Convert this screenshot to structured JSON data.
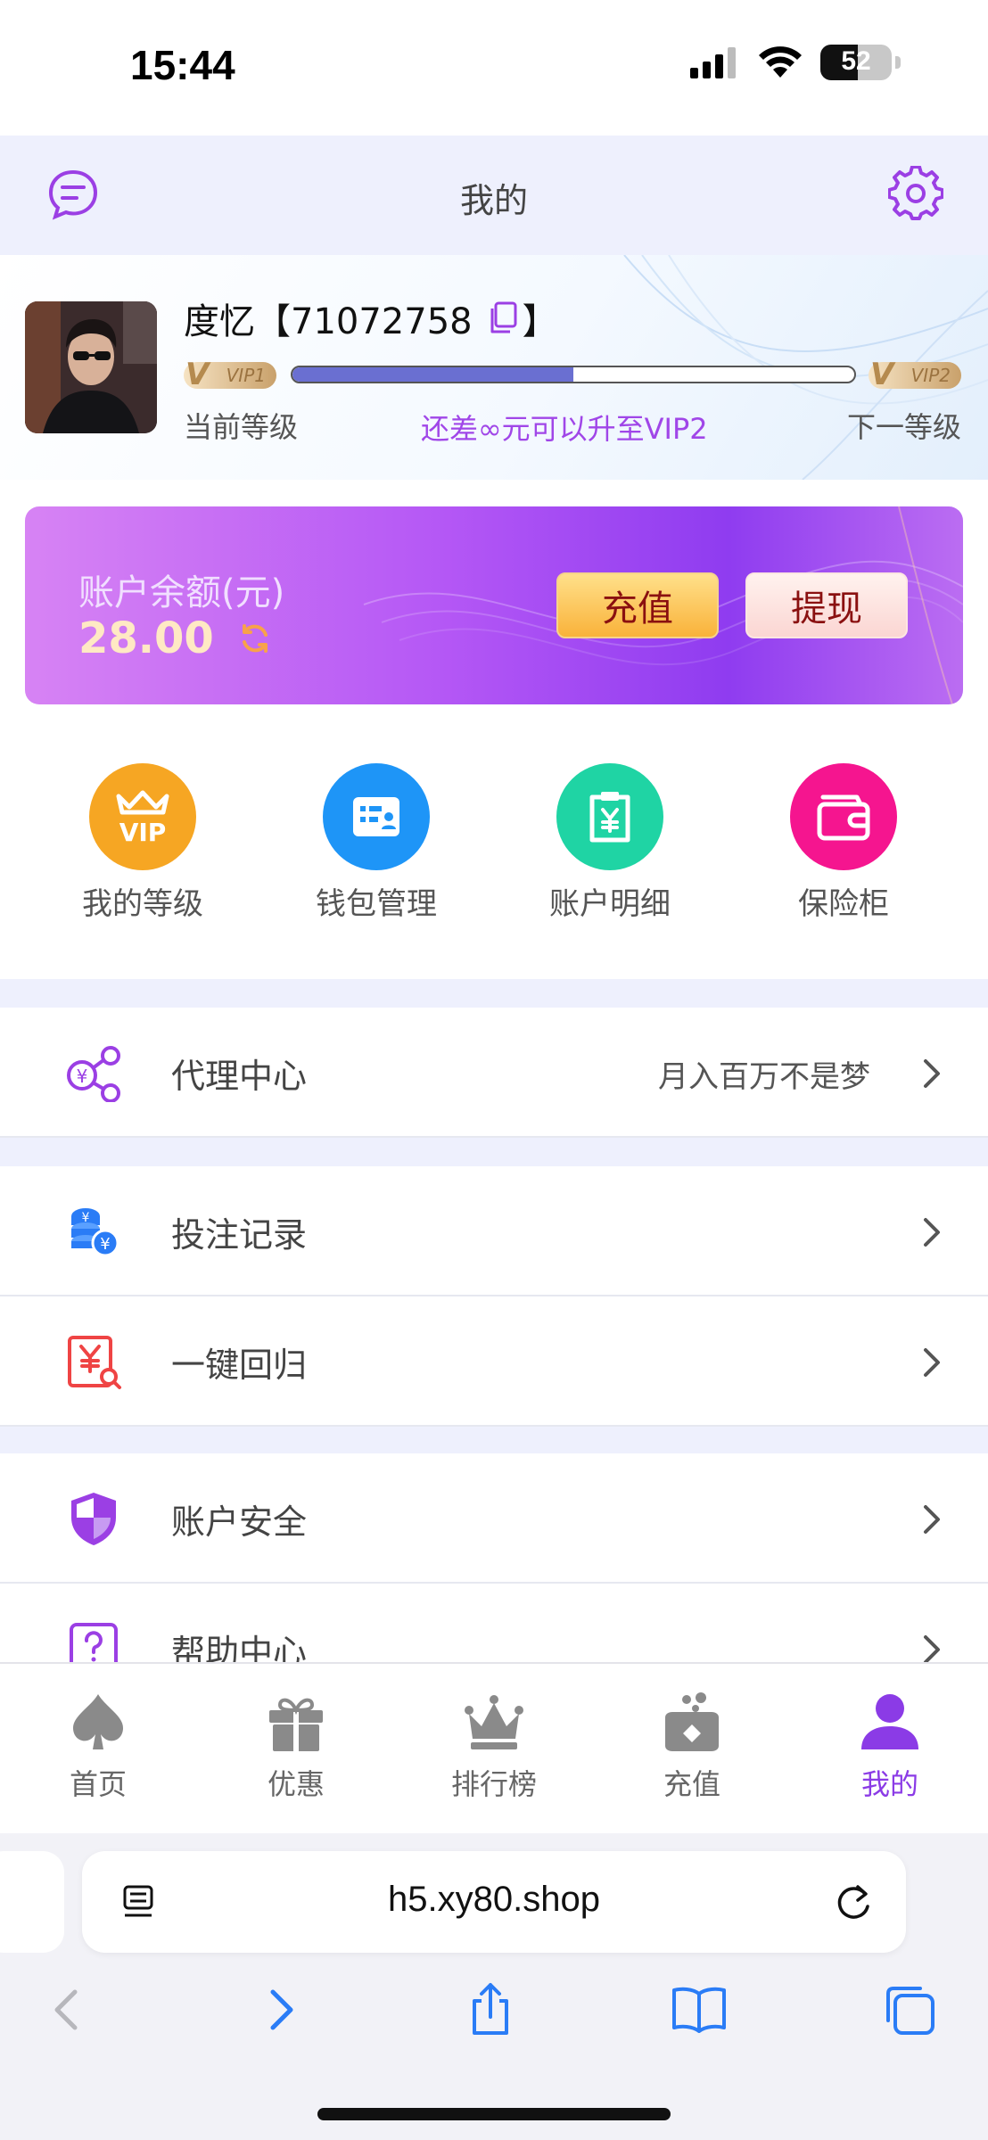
{
  "status": {
    "time": "15:44",
    "battery": "52",
    "battery_level": 0.52
  },
  "header": {
    "title": "我的"
  },
  "profile": {
    "name": "度忆【71072758",
    "name_close": "】",
    "vip_current": "VIP1",
    "vip_next": "VIP2",
    "progress": 0.5,
    "current_level_label": "当前等级",
    "upgrade_tip": "还差∞元可以升至VIP2",
    "next_level_label": "下一等级"
  },
  "balance": {
    "label": "账户余额(元)",
    "amount": "28.00",
    "recharge_label": "充值",
    "withdraw_label": "提现"
  },
  "quick_actions": [
    {
      "label": "我的等级",
      "icon": "vip-crown-icon",
      "color": "#f6a623"
    },
    {
      "label": "钱包管理",
      "icon": "wallet-card-icon",
      "color": "#1e95f7"
    },
    {
      "label": "账户明细",
      "icon": "clipboard-yen-icon",
      "color": "#1fd4a4"
    },
    {
      "label": "保险柜",
      "icon": "safe-wallet-icon",
      "color": "#f5158f"
    }
  ],
  "menu": {
    "agent": {
      "label": "代理中心",
      "extra": "月入百万不是梦"
    },
    "bet_records": {
      "label": "投注记录"
    },
    "one_click": {
      "label": "一键回归"
    },
    "security": {
      "label": "账户安全"
    },
    "help": {
      "label": "帮助中心"
    }
  },
  "tabs": [
    {
      "label": "首页",
      "icon": "spade-icon"
    },
    {
      "label": "优惠",
      "icon": "gift-icon"
    },
    {
      "label": "排行榜",
      "icon": "crown-icon"
    },
    {
      "label": "充值",
      "icon": "recharge-icon"
    },
    {
      "label": "我的",
      "icon": "user-icon",
      "active": true
    }
  ],
  "browser": {
    "url": "h5.xy80.shop"
  },
  "colors": {
    "accent": "#8b3be6",
    "header_bg": "#eef0fd",
    "link_blue": "#2a7cf6"
  }
}
